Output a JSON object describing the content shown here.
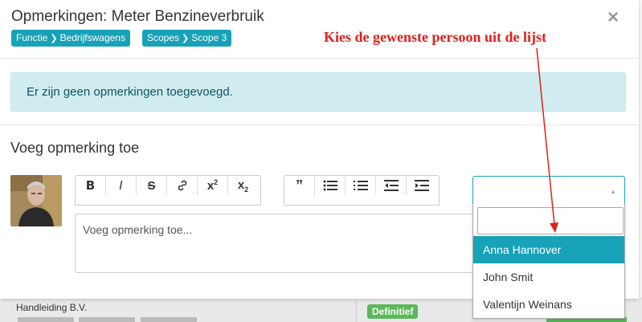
{
  "background": {
    "company": "Handleiding B.V.",
    "badge": "Definitief"
  },
  "modal": {
    "title": "Opmerkingen: Meter Benzineverbruik",
    "close_symbol": "×",
    "tags": [
      {
        "left": "Functie",
        "right": "Bedrijfswagens"
      },
      {
        "left": "Scopes",
        "right": "Scope 3"
      }
    ],
    "alert": "Er zijn geen opmerkingen toegevoegd.",
    "section_title": "Voeg opmerking toe",
    "editor_placeholder": "Voeg opmerking toe...",
    "toolbar_left": [
      {
        "icon": "bold-icon",
        "glyph": "B"
      },
      {
        "icon": "italic-icon",
        "glyph": "I"
      },
      {
        "icon": "strikethrough-icon",
        "glyph": "S"
      },
      {
        "icon": "link-icon",
        "glyph": "🔗"
      },
      {
        "icon": "superscript-icon",
        "glyph": "x²"
      },
      {
        "icon": "subscript-icon",
        "glyph": "x₂"
      }
    ],
    "toolbar_right": [
      {
        "icon": "quote-icon",
        "glyph": "❝"
      },
      {
        "icon": "bullet-list-icon",
        "glyph": "☰"
      },
      {
        "icon": "numbered-list-icon",
        "glyph": "☰"
      },
      {
        "icon": "outdent-icon",
        "glyph": "⇤"
      },
      {
        "icon": "indent-icon",
        "glyph": "⇥"
      }
    ],
    "person_select": {
      "selected": "",
      "search_value": "",
      "options": [
        "Anna Hannover",
        "John Smit",
        "Valentijn Weinans"
      ],
      "highlighted": "Anna Hannover"
    }
  },
  "annotation": "Kies de gewenste persoon uit de lijst",
  "colors": {
    "accent": "#17a2b8",
    "alert_bg": "#d1ecf1",
    "annotation": "#e0201b",
    "badge_green": "#5cb85c"
  }
}
